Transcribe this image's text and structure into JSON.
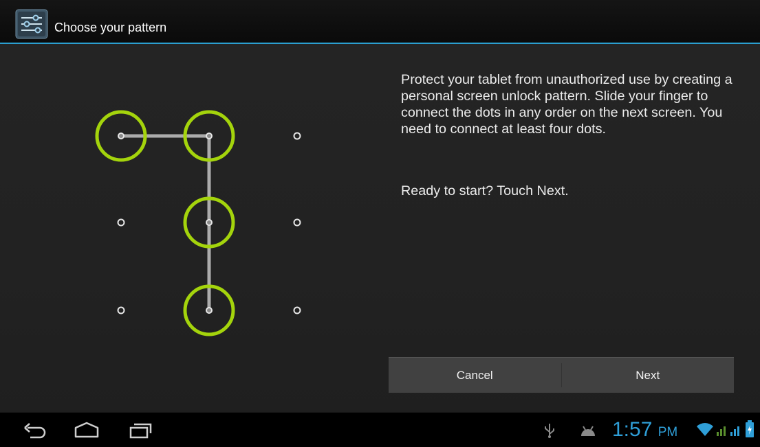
{
  "action_bar": {
    "title": "Choose your pattern",
    "app_icon": "settings-sliders-icon"
  },
  "content": {
    "description": "Protect your tablet from unauthorized use by creating a personal screen unlock pattern. Slide your finger to connect the dots in any order on the next screen. You need to connect at least four dots.",
    "ready_text": "Ready to start? Touch Next."
  },
  "pattern_example": {
    "grid": "3x3",
    "sequence": [
      1,
      2,
      5,
      8
    ],
    "highlight_color": "#a4d40c"
  },
  "buttons": {
    "cancel_label": "Cancel",
    "next_label": "Next"
  },
  "system_bar": {
    "nav": [
      "back-icon",
      "home-icon",
      "recent-apps-icon"
    ],
    "status_icons": [
      "usb-icon",
      "android-debug-icon",
      "wifi-icon",
      "signal-icon",
      "signal-icon",
      "battery-icon"
    ],
    "time": "1:57",
    "ampm": "PM"
  },
  "colors": {
    "accent": "#2b9fd0",
    "pattern_ring": "#a4d40c",
    "clock": "#2f9fd8"
  }
}
